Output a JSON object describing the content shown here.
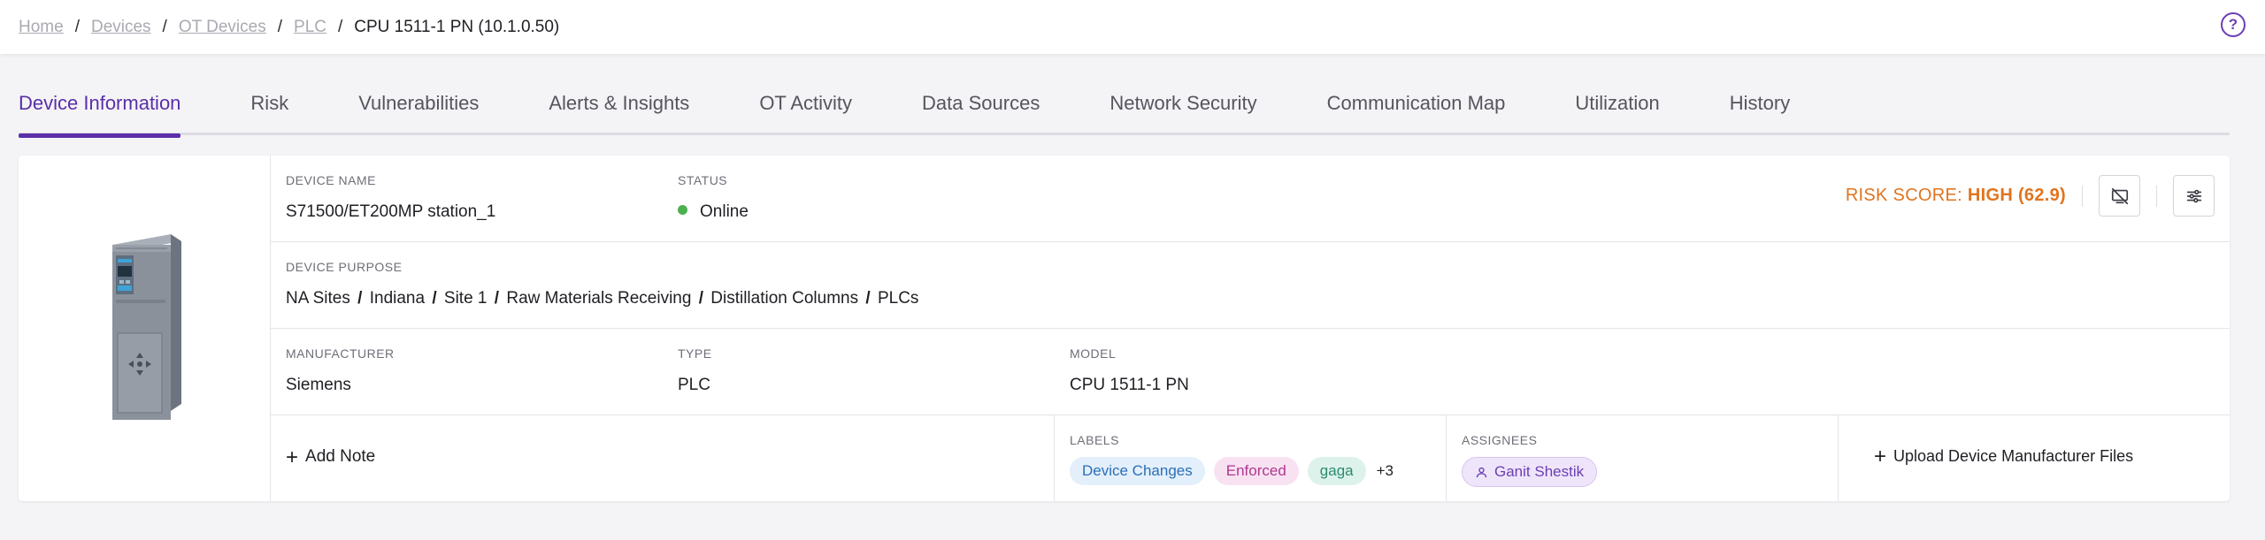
{
  "breadcrumb": {
    "items": [
      "Home",
      "Devices",
      "OT Devices",
      "PLC"
    ],
    "current": "CPU 1511-1 PN (10.1.0.50)",
    "separator": "/"
  },
  "help": {
    "icon": "help-circle-icon",
    "glyph": "?"
  },
  "tabs": [
    {
      "label": "Device Information",
      "active": true
    },
    {
      "label": "Risk"
    },
    {
      "label": "Vulnerabilities"
    },
    {
      "label": "Alerts & Insights"
    },
    {
      "label": "OT Activity"
    },
    {
      "label": "Data Sources"
    },
    {
      "label": "Network Security"
    },
    {
      "label": "Communication Map"
    },
    {
      "label": "Utilization"
    },
    {
      "label": "History"
    }
  ],
  "device": {
    "name_label": "DEVICE NAME",
    "name": "S71500/ET200MP station_1",
    "status_label": "STATUS",
    "status": "Online",
    "status_color": "#4caf50",
    "risk_label": "RISK SCORE:",
    "risk_value": "HIGH (62.9)",
    "risk_color": "#e0741f",
    "purpose_label": "DEVICE PURPOSE",
    "purpose_path": [
      "NA Sites",
      "Indiana",
      "Site 1",
      "Raw Materials Receiving",
      "Distillation Columns",
      "PLCs"
    ],
    "manufacturer_label": "MANUFACTURER",
    "manufacturer": "Siemens",
    "type_label": "TYPE",
    "type": "PLC",
    "model_label": "MODEL",
    "model": "CPU 1511-1 PN"
  },
  "actions": {
    "add_note": "Add Note",
    "upload": "Upload Device Manufacturer Files",
    "hide_icon": "eye-off-icon",
    "settings_icon": "sliders-icon"
  },
  "labels": {
    "title": "LABELS",
    "items": [
      {
        "text": "Device Changes",
        "bg": "#e3effa",
        "color": "#2a6fb8"
      },
      {
        "text": "Enforced",
        "bg": "#f8e2f2",
        "color": "#b0378f"
      },
      {
        "text": "gaga",
        "bg": "#def2ec",
        "color": "#2b8b6e"
      }
    ],
    "more": "+3"
  },
  "assignees": {
    "title": "ASSIGNEES",
    "items": [
      {
        "name": "Ganit Shestik",
        "bg": "#efe5fa",
        "color": "#6b3fb5"
      }
    ]
  }
}
